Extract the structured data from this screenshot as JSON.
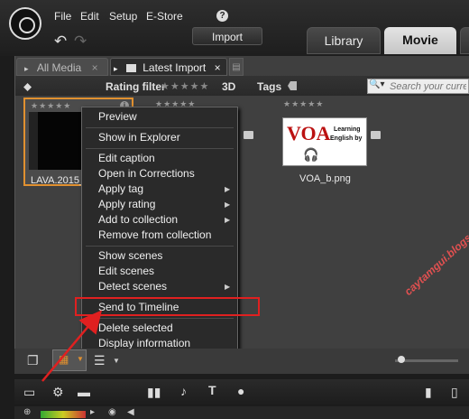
{
  "menubar": {
    "items": [
      "File",
      "Edit",
      "Setup",
      "E-Store"
    ],
    "help_label": "?"
  },
  "toolbar": {
    "import_label": "Import"
  },
  "main_tabs": {
    "library": "Library",
    "movie": "Movie"
  },
  "doc_tabs": {
    "all_media": {
      "label": "All Media",
      "close": "×"
    },
    "latest_import": {
      "label": "Latest Import",
      "close": "×"
    }
  },
  "filters": {
    "rating_filter": "Rating filter",
    "stars": "★★★★★",
    "three_d": "3D",
    "tags": "Tags",
    "search_placeholder": "Search your current view"
  },
  "media": [
    {
      "label": "LAVA.2015_",
      "stars": "★★★★★",
      "selected": true,
      "info": "i"
    },
    {
      "label": "",
      "stars": "★★★★★"
    },
    {
      "label": "VOA_b.png",
      "stars": "★★★★★",
      "card_logo": "VOA",
      "card_line1": "Learning",
      "card_line2": "English by"
    }
  ],
  "context_menu": {
    "items": [
      {
        "label": "Preview"
      },
      {
        "label": "Show in Explorer"
      },
      {
        "label": "Edit caption"
      },
      {
        "label": "Open in Corrections"
      },
      {
        "label": "Apply tag",
        "submenu": true
      },
      {
        "label": "Apply rating",
        "submenu": true
      },
      {
        "label": "Add to collection",
        "submenu": true
      },
      {
        "label": "Remove from collection"
      },
      {
        "label": "Show scenes"
      },
      {
        "label": "Edit scenes"
      },
      {
        "label": "Detect scenes",
        "submenu": true
      },
      {
        "label": "Send to Timeline",
        "highlighted": true
      },
      {
        "label": "Delete selected"
      },
      {
        "label": "Display information"
      }
    ]
  },
  "watermark": "caytamgui.blogspot.com",
  "colors": {
    "selection_border": "#e09030",
    "highlight_box": "#e02020",
    "arrow": "#e02020"
  }
}
